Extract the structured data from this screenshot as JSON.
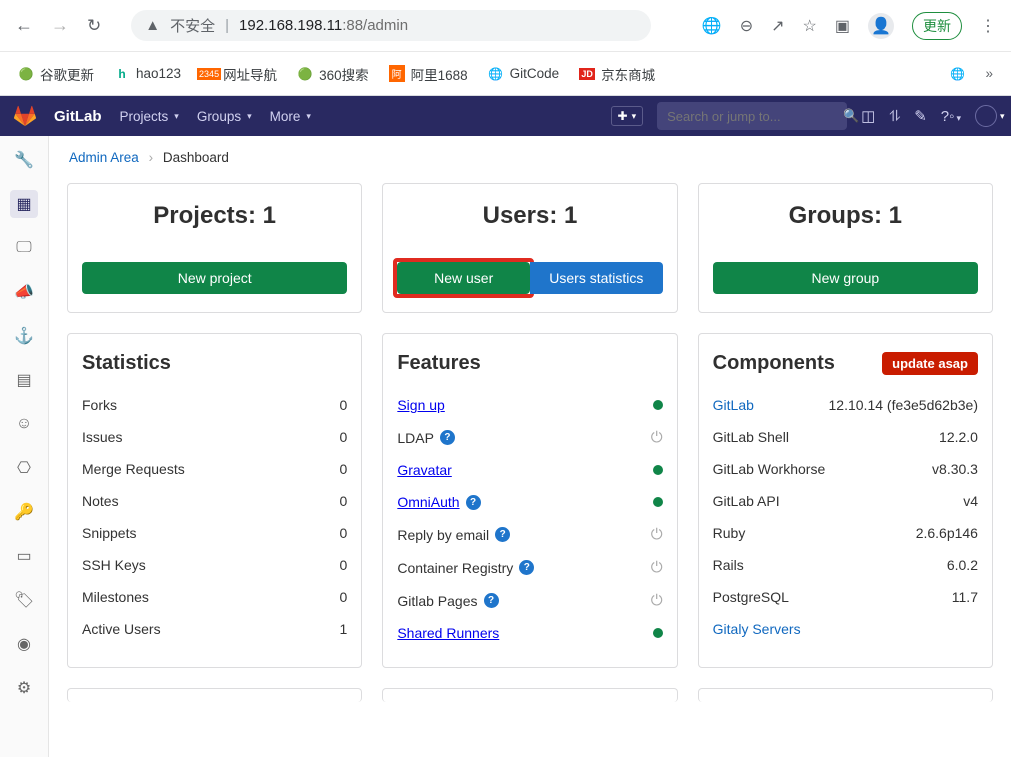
{
  "browser": {
    "insecure_label": "不安全",
    "url_host": "192.168.198.11",
    "url_port_path": ":88/admin",
    "update_label": "更新"
  },
  "bookmarks": [
    {
      "label": "谷歌更新",
      "icon": "chrome"
    },
    {
      "label": "hao123",
      "icon": "hao"
    },
    {
      "label": "网址导航",
      "icon": "2345"
    },
    {
      "label": "360搜索",
      "icon": "360"
    },
    {
      "label": "阿里1688",
      "icon": "1688"
    },
    {
      "label": "GitCode",
      "icon": "globe"
    },
    {
      "label": "京东商城",
      "icon": "jd"
    }
  ],
  "header": {
    "brand": "GitLab",
    "menu": {
      "projects": "Projects",
      "groups": "Groups",
      "more": "More"
    },
    "search_placeholder": "Search or jump to..."
  },
  "breadcrumb": {
    "admin": "Admin Area",
    "current": "Dashboard"
  },
  "summary": {
    "projects": {
      "title": "Projects: 1",
      "btn": "New project"
    },
    "users": {
      "title": "Users: 1",
      "new_btn": "New user",
      "stats_btn": "Users statistics"
    },
    "groups": {
      "title": "Groups: 1",
      "btn": "New group"
    }
  },
  "statistics": {
    "heading": "Statistics",
    "rows": [
      {
        "label": "Forks",
        "value": "0"
      },
      {
        "label": "Issues",
        "value": "0"
      },
      {
        "label": "Merge Requests",
        "value": "0"
      },
      {
        "label": "Notes",
        "value": "0"
      },
      {
        "label": "Snippets",
        "value": "0"
      },
      {
        "label": "SSH Keys",
        "value": "0"
      },
      {
        "label": "Milestones",
        "value": "0"
      },
      {
        "label": "Active Users",
        "value": "1"
      }
    ]
  },
  "features": {
    "heading": "Features",
    "rows": [
      {
        "label": "Sign up",
        "link": true,
        "help": false,
        "status": "on"
      },
      {
        "label": "LDAP",
        "link": false,
        "help": true,
        "status": "off"
      },
      {
        "label": "Gravatar",
        "link": true,
        "help": false,
        "status": "on"
      },
      {
        "label": "OmniAuth",
        "link": true,
        "help": true,
        "status": "on"
      },
      {
        "label": "Reply by email",
        "link": false,
        "help": true,
        "status": "off"
      },
      {
        "label": "Container Registry",
        "link": false,
        "help": true,
        "status": "off"
      },
      {
        "label": "Gitlab Pages",
        "link": false,
        "help": true,
        "status": "off"
      },
      {
        "label": "Shared Runners",
        "link": true,
        "help": false,
        "status": "on"
      }
    ]
  },
  "components": {
    "heading": "Components",
    "update_btn": "update asap",
    "rows": [
      {
        "label": "GitLab",
        "link": true,
        "value": "12.10.14 (fe3e5d62b3e)"
      },
      {
        "label": "GitLab Shell",
        "link": false,
        "value": "12.2.0"
      },
      {
        "label": "GitLab Workhorse",
        "link": false,
        "value": "v8.30.3"
      },
      {
        "label": "GitLab API",
        "link": false,
        "value": "v4"
      },
      {
        "label": "Ruby",
        "link": false,
        "value": "2.6.6p146"
      },
      {
        "label": "Rails",
        "link": false,
        "value": "6.0.2"
      },
      {
        "label": "PostgreSQL",
        "link": false,
        "value": "11.7"
      },
      {
        "label": "Gitaly Servers",
        "link": true,
        "value": ""
      }
    ]
  }
}
